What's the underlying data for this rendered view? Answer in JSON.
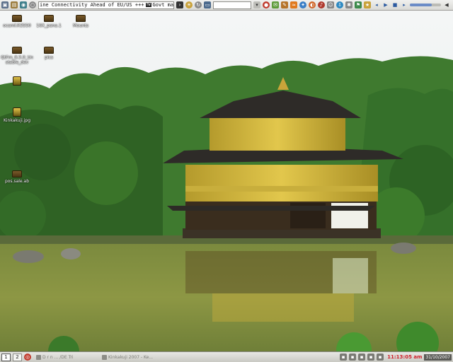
{
  "top_panel": {
    "ticker_text": "ine Connectivity Ahead of EU/US +++",
    "ticker_badge": "TW",
    "ticker_text_2": "Govt may",
    "search_placeholder": "",
    "volume_level": 0.7,
    "left_icons": [
      "computer-icon",
      "files-icon",
      "network-icon",
      "globe-icon"
    ],
    "right_icons": [
      "terminal-icon",
      "weather-icon",
      "mail-icon",
      "chat-icon",
      "rss-icon",
      "music-icon",
      "firefox-icon",
      "skype-icon",
      "download-icon",
      "flag-icon",
      "play-icon",
      "stop-icon",
      "next-icon"
    ]
  },
  "desktop": {
    "icons": [
      {
        "name": "desktop-icon-ocaml",
        "label": "ocaml.R3550",
        "kind": "folder"
      },
      {
        "name": "desktop-icon-16x-pana",
        "label": "16X_pana.1",
        "kind": "folder"
      },
      {
        "name": "desktop-icon-mounts",
        "label": "Mounts",
        "kind": "folder"
      },
      {
        "name": "desktop-icon-qtfm",
        "label": "QtFm_0.3.0_Unstable_dev",
        "kind": "folder"
      },
      {
        "name": "desktop-icon-pics",
        "label": "pics",
        "kind": "folder"
      },
      {
        "name": "desktop-icon-img1",
        "label": "",
        "kind": "image"
      },
      {
        "name": "desktop-icon-kinkakuji",
        "label": "Kinkakuji.jpg",
        "kind": "image"
      },
      {
        "name": "desktop-icon-pos",
        "label": "pos.sale.ab",
        "kind": "folder"
      }
    ]
  },
  "bottom_panel": {
    "workspaces": [
      "1",
      "2"
    ],
    "tasks": [
      {
        "label": "D r n ... /DE Tri"
      },
      {
        "label": "Kinkakuji 2007 - Ke..."
      }
    ],
    "clock": "11:13:05 am",
    "date": "31/10/2007"
  }
}
